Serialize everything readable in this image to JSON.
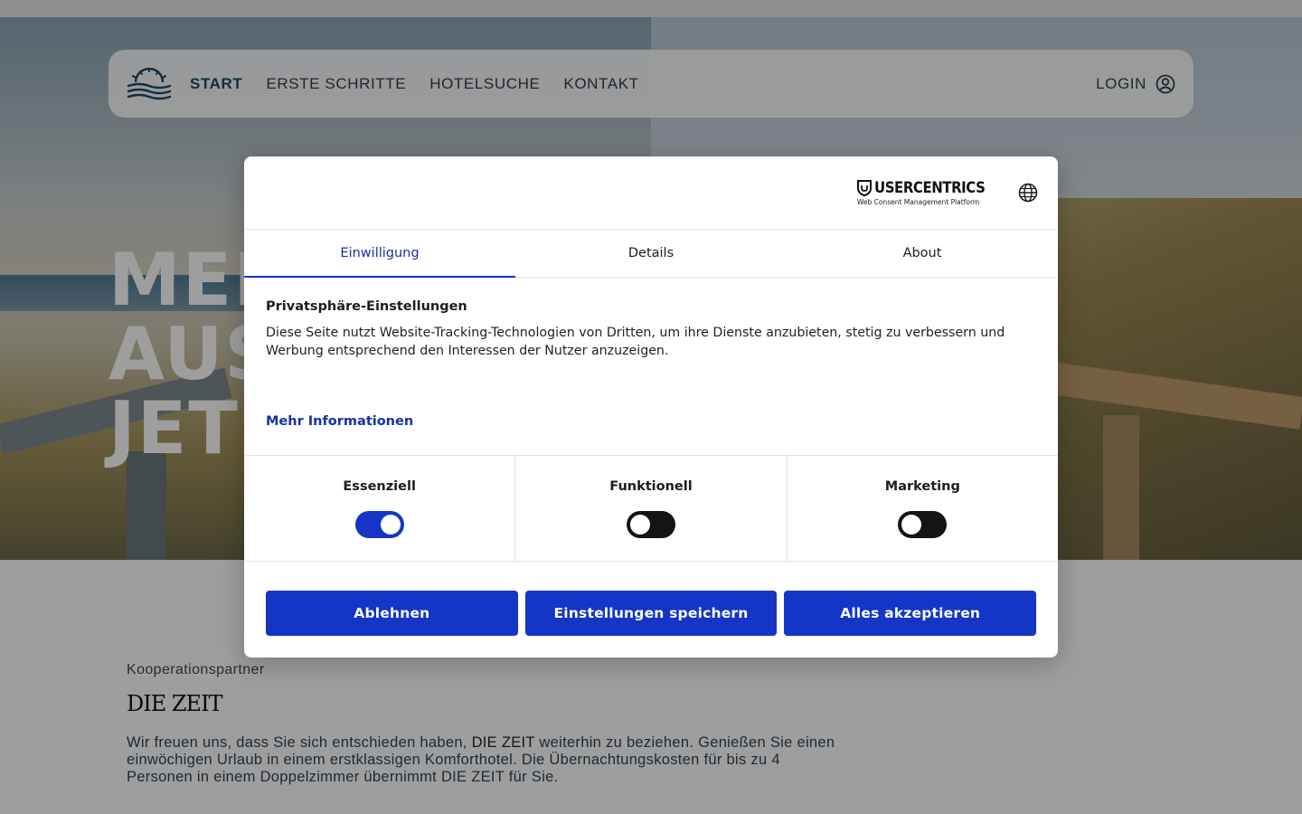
{
  "colors": {
    "accent": "#1535c7",
    "accent_text": "#1432a8",
    "toggle_off": "#141414"
  },
  "nav": {
    "items": [
      {
        "label": "START",
        "active": true
      },
      {
        "label": "ERSTE SCHRITTE",
        "active": false
      },
      {
        "label": "HOTELSUCHE",
        "active": false
      },
      {
        "label": "KONTAKT",
        "active": false
      }
    ],
    "login_label": "LOGIN",
    "logo_icon": "sun-waves-logo",
    "login_icon": "user-circle-icon"
  },
  "hero": {
    "title_lines": [
      "MEI",
      "AUS",
      "JET"
    ]
  },
  "partner": {
    "label": "Kooperationspartner",
    "logo_text": "DIE ZEIT",
    "text_before": "Wir freuen uns, dass Sie sich entschieden haben, ",
    "text_highlight": "DIE ZEIT",
    "text_after": " weiterhin zu beziehen. Genießen Sie einen einwöchigen Urlaub in einem erstklassigen Komforthotel. Die Übernachtungskosten für bis zu 4 Personen in einem Doppelzimmer übernimmt DIE ZEIT für Sie."
  },
  "consent": {
    "brand_name": "USERCENTRICS",
    "brand_tagline": "Web Consent Management Platform",
    "language_icon": "globe-icon",
    "tabs": [
      {
        "label": "Einwilligung",
        "active": true
      },
      {
        "label": "Details",
        "active": false
      },
      {
        "label": "About",
        "active": false
      }
    ],
    "heading": "Privatsphäre-Einstellungen",
    "description": "Diese Seite nutzt Website-Tracking-Technologien von Dritten, um ihre Dienste anzubieten, stetig zu verbessern und Werbung entsprechend den Interessen der Nutzer anzuzeigen.",
    "more_info": "Mehr Informationen",
    "categories": [
      {
        "label": "Essenziell",
        "enabled": true
      },
      {
        "label": "Funktionell",
        "enabled": false
      },
      {
        "label": "Marketing",
        "enabled": false
      }
    ],
    "buttons": {
      "deny": "Ablehnen",
      "save": "Einstellungen speichern",
      "accept_all": "Alles akzeptieren"
    }
  }
}
